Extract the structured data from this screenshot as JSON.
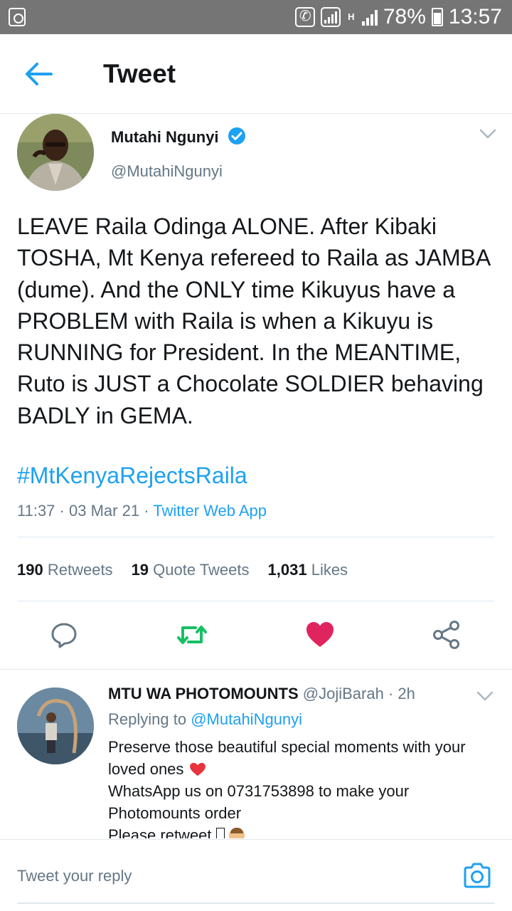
{
  "status_bar": {
    "battery": "78%",
    "time": "13:57",
    "network": "H"
  },
  "header": {
    "title": "Tweet",
    "back_icon": "arrow-left-icon"
  },
  "tweet": {
    "author_name": "Mutahi Ngunyi",
    "author_handle": "@MutahiNgunyi",
    "verified": true,
    "text": "LEAVE Raila Odinga ALONE. After Kibaki TOSHA, Mt Kenya refereed to Raila as JAMBA (dume). And the ONLY time Kikuyus have a PROBLEM with Raila is when a Kikuyu is RUNNING for President. In the MEANTIME, Ruto is JUST a Chocolate SOLDIER behaving BADLY in GEMA.",
    "hashtag": "#MtKenyaRejectsRaila",
    "time": "11:37",
    "date": "03 Mar 21",
    "source": "Twitter Web App",
    "retweets": "190",
    "retweets_label": "Retweets",
    "quote_tweets": "19",
    "quote_tweets_label": "Quote Tweets",
    "likes": "1,031",
    "likes_label": "Likes",
    "liked": true
  },
  "reply": {
    "author_name": "MTU WA PHOTOMOUNTS",
    "author_handle": "@JojiBarah",
    "age": "2h",
    "replying_prefix": "Replying to",
    "replying_to": "@MutahiNgunyi",
    "line1": "Preserve those beautiful  special moments with your loved ones",
    "line2": "WhatsApp us on 0731753898 to make your Photomounts order",
    "line3": "Please retweet"
  },
  "compose": {
    "placeholder": "Tweet your reply",
    "camera_icon": "camera-icon"
  },
  "colors": {
    "accent": "#1da1f2",
    "like": "#e0245e",
    "retweet": "#17bf63",
    "muted": "#657786",
    "status_bar": "#757575"
  }
}
